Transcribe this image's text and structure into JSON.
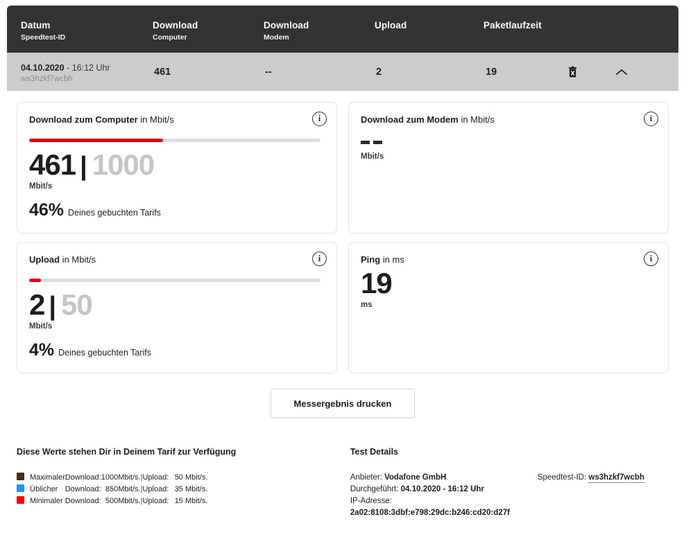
{
  "table": {
    "columns": [
      {
        "main": "Datum",
        "sub": "Speedtest-ID"
      },
      {
        "main": "Download",
        "sub": "Computer"
      },
      {
        "main": "Download",
        "sub": "Modem"
      },
      {
        "main": "Upload",
        "sub": ""
      },
      {
        "main": "Paketlaufzeit",
        "sub": ""
      }
    ],
    "row": {
      "date": "04.10.2020",
      "separator": "-",
      "time": "16:12 Uhr",
      "speedtest_id": "ws3hzkf7wcbh",
      "download_computer": "461",
      "download_modem": "--",
      "upload": "2",
      "paketlaufzeit": "19",
      "delete_icon": "trash-icon",
      "collapse_icon": "chevron-up-icon"
    }
  },
  "cards": {
    "download_computer": {
      "title_bold": "Download zum Computer",
      "title_rest": " in Mbit/s",
      "info_icon": "info-icon",
      "value": "461",
      "pipe": "|",
      "max": "1000",
      "unit": "Mbit/s",
      "percent": "46%",
      "percent_label": "Deines gebuchten Tarifs",
      "bar_fill_percent": 46
    },
    "download_modem": {
      "title_bold": "Download zum Modem",
      "title_rest": " in Mbit/s",
      "info_icon": "info-icon",
      "value": "--",
      "unit": "Mbit/s"
    },
    "upload": {
      "title_bold": "Upload",
      "title_rest": " in Mbit/s",
      "info_icon": "info-icon",
      "value": "2",
      "pipe": "|",
      "max": "50",
      "unit": "Mbit/s",
      "percent": "4%",
      "percent_label": "Deines gebuchten Tarifs",
      "bar_fill_percent": 4
    },
    "ping": {
      "title_bold": "Ping",
      "title_rest": " in ms",
      "info_icon": "info-icon",
      "value": "19",
      "unit": "ms"
    }
  },
  "print_button": {
    "label": "Messergebnis drucken"
  },
  "tariff": {
    "title": "Diese Werte stehen Dir in Deinem Tarif zur Verfügung",
    "download_label": "Download:",
    "upload_label": "Upload:",
    "pipe": "|",
    "rows": [
      {
        "name": "Maximaler",
        "color": "#4a2c12",
        "download": "1000Mbit/s.",
        "upload": "50 Mbit/s."
      },
      {
        "name": "Üblicher",
        "color": "#1e90ff",
        "download": "850Mbit/s.",
        "upload": "35 Mbit/s."
      },
      {
        "name": "Minimaler",
        "color": "#ff0000",
        "download": "500Mbit/s.",
        "upload": "15 Mbit/s."
      }
    ]
  },
  "test_details": {
    "title": "Test Details",
    "provider_label": "Anbieter:",
    "provider_value": "Vodafone GmbH",
    "performed_label": "Durchgeführt:",
    "performed_value": "04.10.2020 - 16:12 Uhr",
    "ip_label": "IP-Adresse:",
    "ip_value": "2a02:8108:3dbf:e798:29dc:b246:cd20:d27f",
    "speedtest_id_label": "Speedtest-ID:",
    "speedtest_id_value": "ws3hzkf7wcbh"
  },
  "colors": {
    "accent_red": "#e60000",
    "header_dark": "#333333",
    "row_grey": "#cccccc",
    "track_grey": "#d8dee6",
    "muted_grey": "#c5c5c5"
  }
}
